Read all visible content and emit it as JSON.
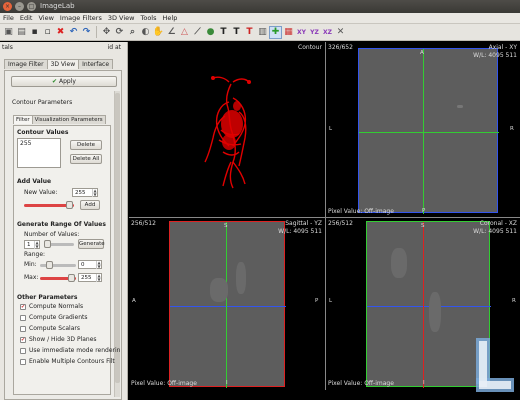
{
  "window": {
    "title": "ImageLab"
  },
  "menu": [
    "File",
    "Edit",
    "View",
    "Image Filters",
    "3D View",
    "Tools",
    "Help"
  ],
  "dock": {
    "title": "tals",
    "right": "id at"
  },
  "tabs": [
    "Image Filter",
    "3D View",
    "Interface"
  ],
  "apply_label": "Apply",
  "section_title": "Contour Parameters",
  "subtabs": [
    "Filter",
    "Visualization Parameters"
  ],
  "contour": {
    "heading": "Contour Values",
    "values": [
      "255"
    ],
    "delete_label": "Delete",
    "delete_all_label": "Delete All"
  },
  "add_value": {
    "heading": "Add Value",
    "new_value_label": "New Value:",
    "new_value": "255",
    "add_label": "Add"
  },
  "generate": {
    "heading": "Generate Range Of Values",
    "number_label": "Number of Values:",
    "number": "1",
    "generate_label": "Generate",
    "range_label": "Range:",
    "min_label": "Min:",
    "min_value": "0",
    "max_label": "Max:",
    "max_value": "255"
  },
  "other": {
    "heading": "Other Parameters",
    "options": [
      {
        "label": "Compute Normals",
        "checked": true
      },
      {
        "label": "Compute Gradients",
        "checked": false
      },
      {
        "label": "Compute Scalars",
        "checked": false
      },
      {
        "label": "Show / Hide 3D Planes",
        "checked": true
      },
      {
        "label": "Use immediate mode renderin",
        "checked": false
      },
      {
        "label": "Enable Multiple Contours Filt",
        "checked": false
      }
    ]
  },
  "views": {
    "contour": {
      "title": "Contour"
    },
    "axial": {
      "index": "326/652",
      "title": "Axial - XY",
      "wl": "W/L: 4095 511",
      "pixel": "Pixel Value: Off-image",
      "top": "A",
      "bottom": "P",
      "left": "L",
      "right": "R"
    },
    "sagittal": {
      "index": "256/512",
      "title": "Sagittal - YZ",
      "wl": "W/L: 4095 511",
      "pixel": "Pixel Value: Off-image",
      "top": "S",
      "bottom": "I",
      "left": "A",
      "right": "P"
    },
    "coronal": {
      "index": "256/512",
      "title": "Coronal - XZ",
      "wl": "W/L: 4095 511",
      "pixel": "Pixel Value: Off-image",
      "top": "S",
      "bottom": "I",
      "left": "L",
      "right": "R"
    }
  },
  "colors": {
    "contour": "#e00000",
    "grey_slice": "#5d5d5d",
    "crosshair_green": "#33cc33",
    "crosshair_blue": "#3355ee",
    "crosshair_red": "#dd2222"
  }
}
